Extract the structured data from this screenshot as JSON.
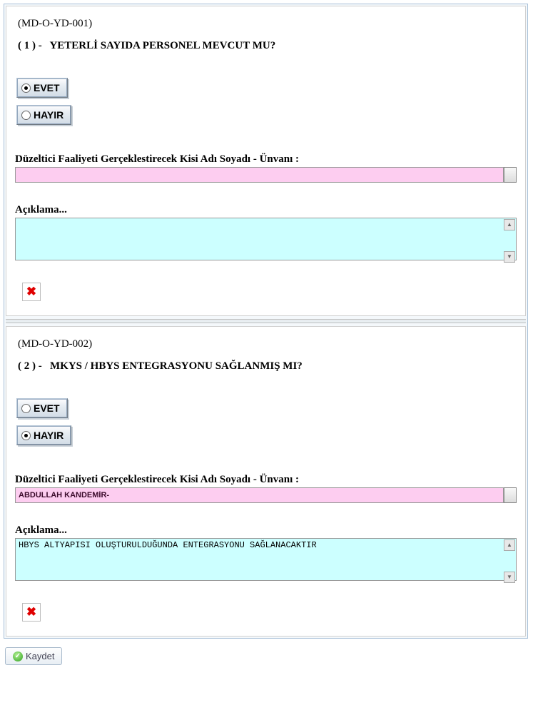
{
  "questions": [
    {
      "code": "(MD-O-YD-001)",
      "number": "( 1 ) -",
      "text": "YETERLİ SAYIDA PERSONEL MEVCUT MU?",
      "options": {
        "evet": "EVET",
        "hayir": "HAYIR"
      },
      "selected": "evet",
      "person_label": "Düzeltici Faaliyeti Gerçeklestirecek Kisi Adı Soyadı - Ünvanı :",
      "person_value": "",
      "desc_label": "Açıklama...",
      "desc_value": ""
    },
    {
      "code": "(MD-O-YD-002)",
      "number": "( 2 ) -",
      "text": "MKYS / HBYS ENTEGRASYONU SAĞLANMIŞ MI?",
      "options": {
        "evet": "EVET",
        "hayir": "HAYIR"
      },
      "selected": "hayir",
      "person_label": "Düzeltici Faaliyeti Gerçeklestirecek Kisi Adı Soyadı - Ünvanı :",
      "person_value": "ABDULLAH KANDEMİR-",
      "desc_label": "Açıklama...",
      "desc_value": "HBYS ALTYAPISI OLUŞTURULDUĞUNDA ENTEGRASYONU SAĞLANACAKTIR"
    }
  ],
  "buttons": {
    "save": "Kaydet"
  }
}
